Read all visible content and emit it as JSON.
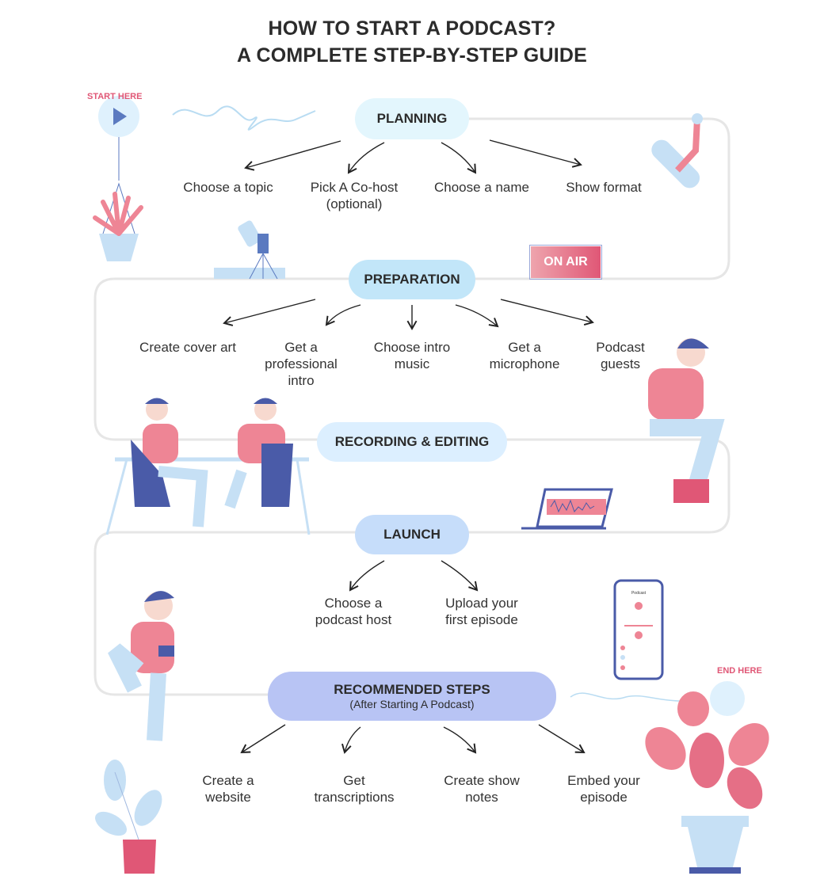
{
  "title": {
    "line1": "HOW TO START A PODCAST?",
    "line2": "A COMPLETE STEP-BY-STEP GUIDE"
  },
  "start_badge": "START HERE",
  "end_badge": "END HERE",
  "on_air_sign": "ON AIR",
  "phone_screen_title": "Podcast",
  "colors": {
    "path": "#e6e6e6",
    "planning": "#e3f6fd",
    "preparation": "#c2e6f9",
    "recording": "#dcefff",
    "launch": "#c6ddfa",
    "recommended": "#b8c4f4",
    "accent_pink": "#e05776"
  },
  "stages": {
    "planning": {
      "label": "PLANNING",
      "steps": [
        "Choose a topic",
        "Pick A Co-host (optional)",
        "Choose a name",
        "Show format"
      ]
    },
    "preparation": {
      "label": "PREPARATION",
      "steps": [
        "Create cover art",
        "Get a professional intro",
        "Choose intro music",
        "Get a microphone",
        "Podcast guests"
      ]
    },
    "recording": {
      "label": "RECORDING & EDITING"
    },
    "launch": {
      "label": "LAUNCH",
      "steps": [
        "Choose a podcast host",
        "Upload your first episode"
      ]
    },
    "recommended": {
      "label": "RECOMMENDED STEPS",
      "sublabel": "(After Starting A Podcast)",
      "steps": [
        "Create a website",
        "Get transcriptions",
        "Create show notes",
        "Embed your episode"
      ]
    }
  }
}
